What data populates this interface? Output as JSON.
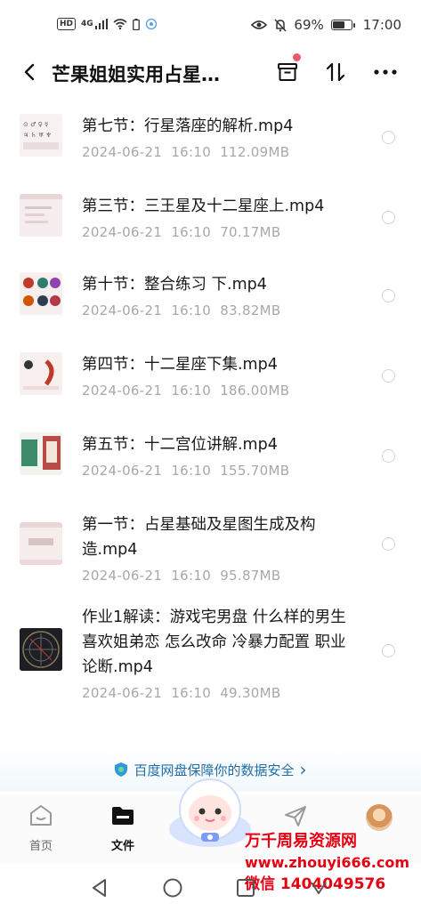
{
  "status_bar": {
    "hd": "HD",
    "network": "4G",
    "battery_text": "69%",
    "battery_level": 0.69,
    "time": "17:00"
  },
  "header": {
    "title": "芒果姐姐实用占星…",
    "icons": [
      "back-arrow-icon",
      "archive-icon",
      "sort-icon",
      "more-icon"
    ]
  },
  "files": [
    {
      "name": "第七节：行星落座的解析.mp4",
      "date": "2024-06-21",
      "time": "16:10",
      "size": "112.09MB"
    },
    {
      "name": "第三节：三王星及十二星座上.mp4",
      "date": "2024-06-21",
      "time": "16:10",
      "size": "70.17MB"
    },
    {
      "name": "第十节：整合练习 下.mp4",
      "date": "2024-06-21",
      "time": "16:10",
      "size": "83.82MB"
    },
    {
      "name": "第四节：十二星座下集.mp4",
      "date": "2024-06-21",
      "time": "16:10",
      "size": "186.00MB"
    },
    {
      "name": "第五节：十二宫位讲解.mp4",
      "date": "2024-06-21",
      "time": "16:10",
      "size": "155.70MB"
    },
    {
      "name": "第一节：占星基础及星图生成及构造.mp4",
      "date": "2024-06-21",
      "time": "16:10",
      "size": "95.87MB"
    },
    {
      "name": "作业1解读：游戏宅男盘 什么样的男生喜欢姐弟恋 怎么改命 冷暴力配置 职业论断.mp4",
      "date": "2024-06-21",
      "time": "16:10",
      "size": "49.30MB"
    }
  ],
  "safety_banner": {
    "text": "百度网盘保障你的数据安全",
    "chevron": "›"
  },
  "bottom_nav": {
    "home": "首页",
    "files": "文件",
    "share": "",
    "me": ""
  },
  "watermark": {
    "line1": "万千周易资源网",
    "line2": "www.zhouyi666.com",
    "line3": "微信 1404049576"
  },
  "colors": {
    "accent_red": "#e60012",
    "safety_blue": "#1e6ea8",
    "meta_gray": "#a8a8a8"
  }
}
